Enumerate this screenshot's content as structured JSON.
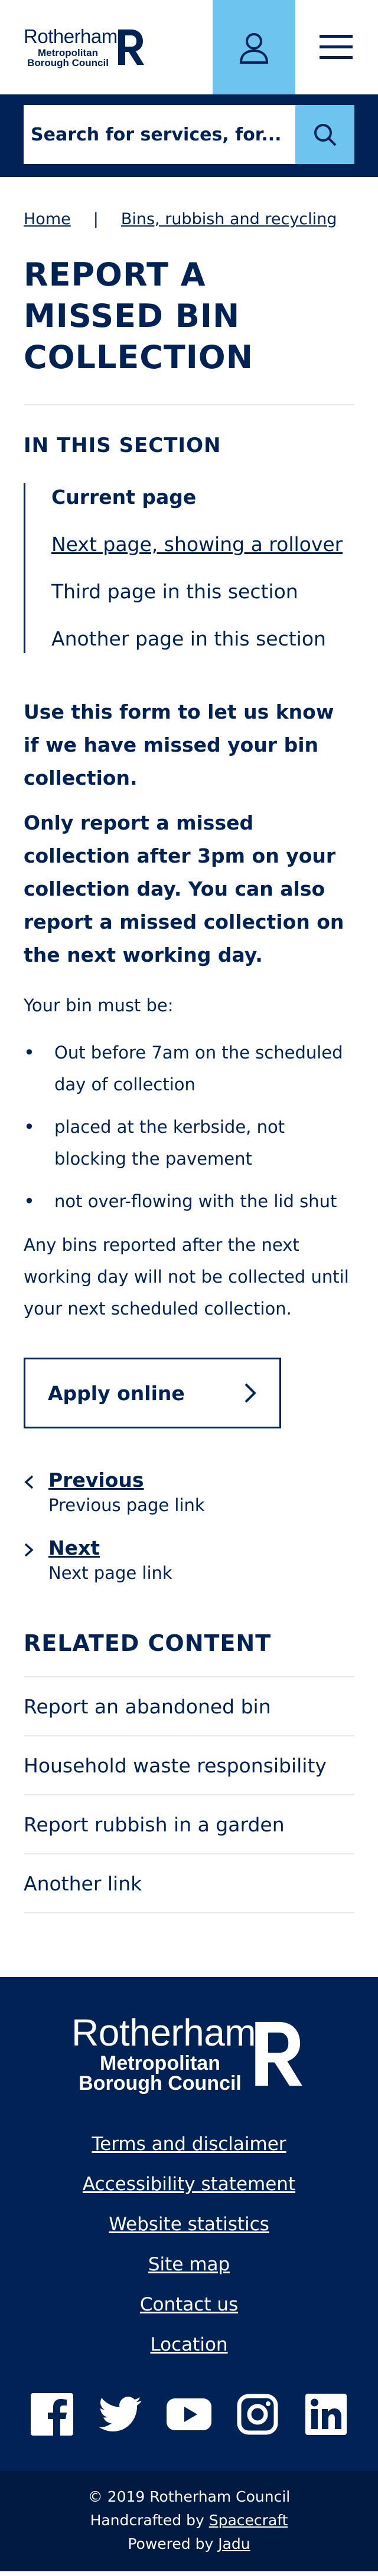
{
  "header": {
    "logo": {
      "line1": "Rotherham",
      "line2": "Metropolitan",
      "line3": "Borough Council"
    }
  },
  "search": {
    "placeholder": "Search for services, for..."
  },
  "breadcrumb": {
    "items": [
      "Home",
      "Bins, rubbish and recycling"
    ],
    "separator": "|"
  },
  "page_title": "REPORT A MISSED BIN COLLECTION",
  "section_nav": {
    "title": "IN THIS SECTION",
    "items": [
      "Current page",
      "Next page, showing a rollover",
      "Third page in this section",
      "Another page in this section"
    ]
  },
  "content": {
    "intro": "Use this form to let us know if we have missed your bin collection.",
    "intro2": "Only report a missed collection after 3pm on your collection day. You can also report a missed collection on the next working day.",
    "bin_must_be": "Your bin must be:",
    "bullets": [
      "Out before 7am on the scheduled day of collection",
      "placed at the kerbside, not blocking the pavement",
      "not over-flowing with the lid shut"
    ],
    "after_text": "Any bins reported after the next working day will not be collected until your next scheduled collection."
  },
  "apply_button": {
    "label": "Apply online"
  },
  "pager": {
    "previous": {
      "title": "Previous",
      "sub": "Previous page link"
    },
    "next": {
      "title": "Next",
      "sub": "Next page link"
    }
  },
  "related": {
    "title": "RELATED CONTENT",
    "items": [
      "Report an abandoned bin",
      "Household waste responsibility",
      "Report rubbish in a garden",
      "Another link"
    ]
  },
  "footer": {
    "logo": {
      "line1": "Rotherham",
      "line2": "Metropolitan",
      "line3": "Borough Council"
    },
    "links": [
      "Terms and disclaimer",
      "Accessibility statement",
      "Website statistics",
      "Site map",
      "Contact us",
      "Location"
    ],
    "social": [
      "facebook-icon",
      "twitter-icon",
      "youtube-icon",
      "instagram-icon",
      "linkedin-icon"
    ],
    "copyright": "© 2019 Rotherham Council",
    "handcrafted_prefix": "Handcrafted by",
    "handcrafted_by": "Spacecraft",
    "powered_prefix": "Powered by",
    "powered_by": "Jadu"
  },
  "colors": {
    "navy": "#002255",
    "accent": "#6cc4ef",
    "white": "#ffffff"
  }
}
